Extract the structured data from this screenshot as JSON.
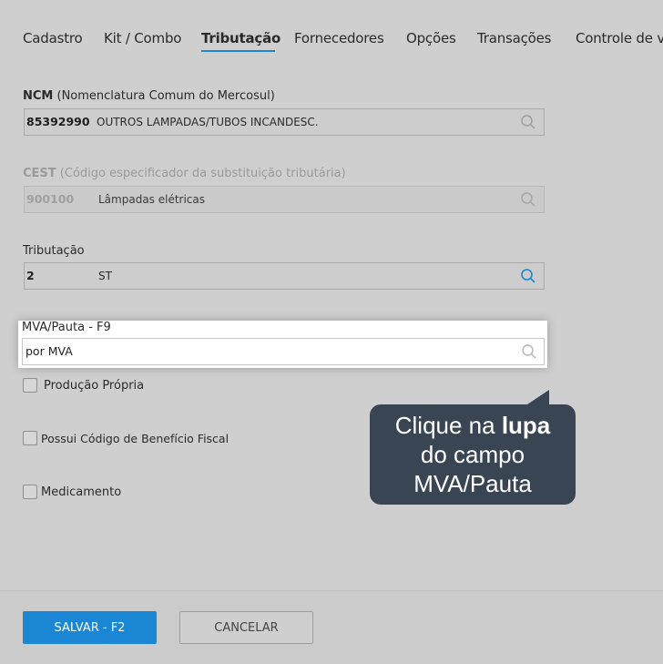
{
  "tabs": [
    {
      "label": "Cadastro"
    },
    {
      "label": "Kit / Combo"
    },
    {
      "label": "Tributação"
    },
    {
      "label": "Fornecedores"
    },
    {
      "label": "Opções"
    },
    {
      "label": "Transações"
    },
    {
      "label": "Controle de v"
    }
  ],
  "active_tab": "Tributação",
  "ncm": {
    "label_bold": "NCM",
    "label_rest": " (Nomenclatura Comum do Mercosul)",
    "code": "85392990",
    "description": "OUTROS LAMPADAS/TUBOS INCANDESC."
  },
  "cest": {
    "label_bold": "CEST",
    "label_rest": " (Código especificador da substituição tributária)",
    "code": "900100",
    "description": "Lâmpadas elétricas"
  },
  "tributacao": {
    "label": "Tributação",
    "code": "2",
    "description": "ST"
  },
  "mva": {
    "label": "MVA/Pauta - F9",
    "value": "por MVA"
  },
  "checkboxes": [
    {
      "label": "Produção Própria",
      "checked": false
    },
    {
      "label": "Possui Código de Benefício Fiscal",
      "checked": false
    },
    {
      "label": "Medicamento",
      "checked": false
    }
  ],
  "tooltip": {
    "line1_pre": "Clique na ",
    "line1_bold": "lupa",
    "line2": "do campo",
    "line3": "MVA/Pauta"
  },
  "footer": {
    "save_label": "SALVAR - F2",
    "cancel_label": "CANCELAR"
  },
  "colors": {
    "accent": "#1a86d4",
    "tooltip_bg": "#3a4553",
    "page_bg": "#cfcfcf"
  },
  "icons": {
    "search": "search-icon"
  }
}
